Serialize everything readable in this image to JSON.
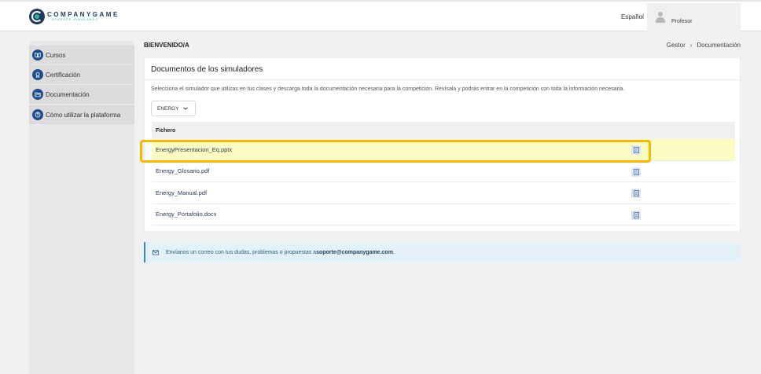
{
  "header": {
    "logo_name": "COMPANYGAME",
    "logo_sub": "APRENDE SIMULANDO",
    "language": "Español",
    "user_name": "Profesor"
  },
  "sidebar": {
    "items": [
      {
        "label": "Cursos",
        "icon": "book-icon"
      },
      {
        "label": "Certificación",
        "icon": "award-icon"
      },
      {
        "label": "Documentación",
        "icon": "folder-icon"
      },
      {
        "label": "Cómo utilizar la plataforma",
        "icon": "help-icon"
      }
    ]
  },
  "main": {
    "welcome": "BIENVENIDO/A",
    "breadcrumb": [
      "Gestor",
      "Documentación"
    ],
    "card": {
      "title": "Documentos de los simuladores",
      "description": "Selecciona el simulador que utilizas en tus clases y descarga toda la documentación necesaria para la competición. Revísala y podrás entrar en la competición con toda la información necesaria.",
      "select_value": "ENERGY",
      "column_header": "Fichero",
      "files": [
        {
          "name": "EnergyPresentacion_Eq.pptx",
          "highlighted": true
        },
        {
          "name": "Energy_Glosario.pdf",
          "highlighted": false
        },
        {
          "name": "Energy_Manual.pdf",
          "highlighted": false
        },
        {
          "name": "Energy_Portafolio.docx",
          "highlighted": false
        }
      ]
    },
    "alert": {
      "text": "Envíanos un correo con tus dudas, problemas o propuestas a ",
      "email": "soporte@companygame.com",
      "end": "."
    }
  },
  "colors": {
    "primary": "#1e4d8c",
    "highlight_fill": "#fcfbc2",
    "highlight_border": "#f0b90b",
    "alert_bg": "#e3f1f9"
  }
}
